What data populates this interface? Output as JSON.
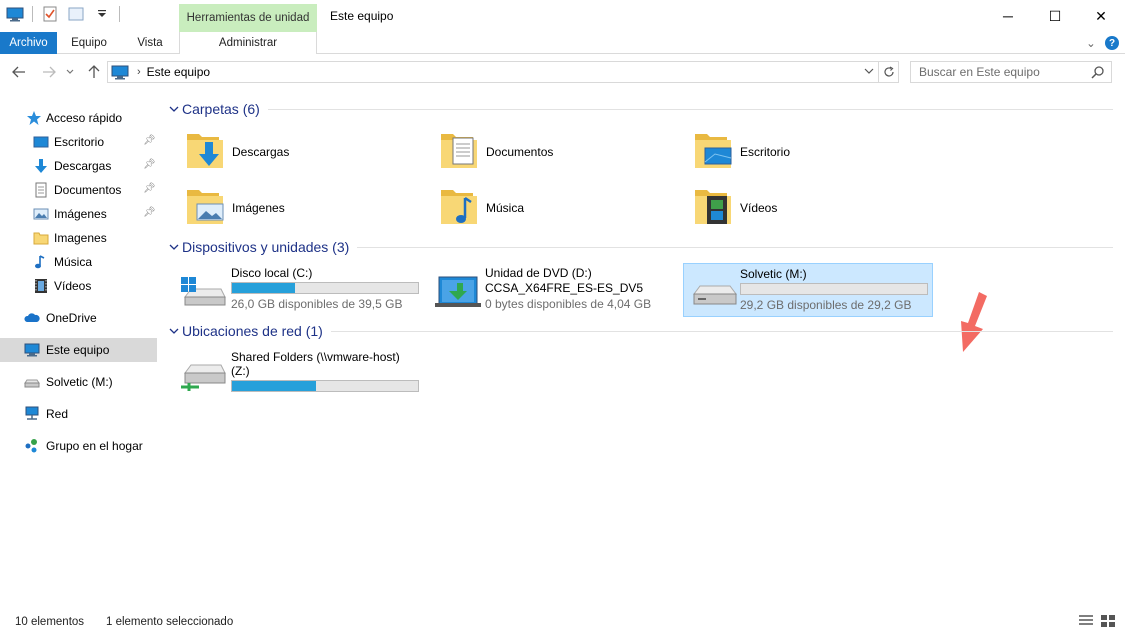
{
  "titlebar": {
    "context_tab": "Herramientas de unidad",
    "title": "Este equipo",
    "minimize": "─",
    "maximize": "☐",
    "close": "✕"
  },
  "ribbon": {
    "tabs": [
      "Archivo",
      "Equipo",
      "Vista",
      "Administrar"
    ],
    "collapse": "⌄",
    "help": "?"
  },
  "address": {
    "path": "Este equipo",
    "search_placeholder": "Buscar en Este equipo"
  },
  "sidebar": {
    "items": [
      {
        "label": "Acceso rápido",
        "icon": "star-icon"
      },
      {
        "label": "Escritorio",
        "icon": "desktop-icon",
        "pinned": true
      },
      {
        "label": "Descargas",
        "icon": "download-icon",
        "pinned": true
      },
      {
        "label": "Documentos",
        "icon": "document-icon",
        "pinned": true
      },
      {
        "label": "Imágenes",
        "icon": "pictures-icon",
        "pinned": true
      },
      {
        "label": "Imagenes",
        "icon": "folder-icon"
      },
      {
        "label": "Música",
        "icon": "music-icon"
      },
      {
        "label": "Vídeos",
        "icon": "video-icon"
      },
      {
        "label": "OneDrive",
        "icon": "onedrive-icon"
      },
      {
        "label": "Este equipo",
        "icon": "computer-icon",
        "selected": true
      },
      {
        "label": "Solvetic (M:)",
        "icon": "drive-icon"
      },
      {
        "label": "Red",
        "icon": "network-icon"
      },
      {
        "label": "Grupo en el hogar",
        "icon": "homegroup-icon"
      }
    ]
  },
  "groups": {
    "folders": {
      "title": "Carpetas (6)",
      "items": [
        {
          "label": "Descargas",
          "icon": "downloads-folder-icon"
        },
        {
          "label": "Documentos",
          "icon": "documents-folder-icon"
        },
        {
          "label": "Escritorio",
          "icon": "desktop-folder-icon"
        },
        {
          "label": "Imágenes",
          "icon": "pictures-folder-icon"
        },
        {
          "label": "Música",
          "icon": "music-folder-icon"
        },
        {
          "label": "Vídeos",
          "icon": "videos-folder-icon"
        }
      ]
    },
    "devices": {
      "title": "Dispositivos y unidades (3)",
      "items": [
        {
          "name": "Disco local (C:)",
          "info": "26,0 GB disponibles de 39,5 GB",
          "used_fraction": 0.34
        },
        {
          "name": "Unidad de DVD (D:)",
          "sub": "CCSA_X64FRE_ES-ES_DV5",
          "info": "0 bytes disponibles de 4,04 GB"
        },
        {
          "name": "Solvetic (M:)",
          "info": "29,2 GB disponibles de 29,2 GB",
          "used_fraction": 0.0,
          "selected": true
        }
      ]
    },
    "network": {
      "title": "Ubicaciones de red (1)",
      "items": [
        {
          "name": "Shared Folders (\\\\vmware-host)",
          "name2": "(Z:)",
          "used_fraction": 0.45
        }
      ]
    }
  },
  "status": {
    "count": "10 elementos",
    "selection": "1 elemento seleccionado"
  },
  "colors": {
    "accent": "#1979ca",
    "group_title": "#1e3287",
    "selection": "#cce8ff",
    "bar_fill": "#26a0da",
    "context_tab": "#c9edbe",
    "arrow": "#f36b63"
  }
}
